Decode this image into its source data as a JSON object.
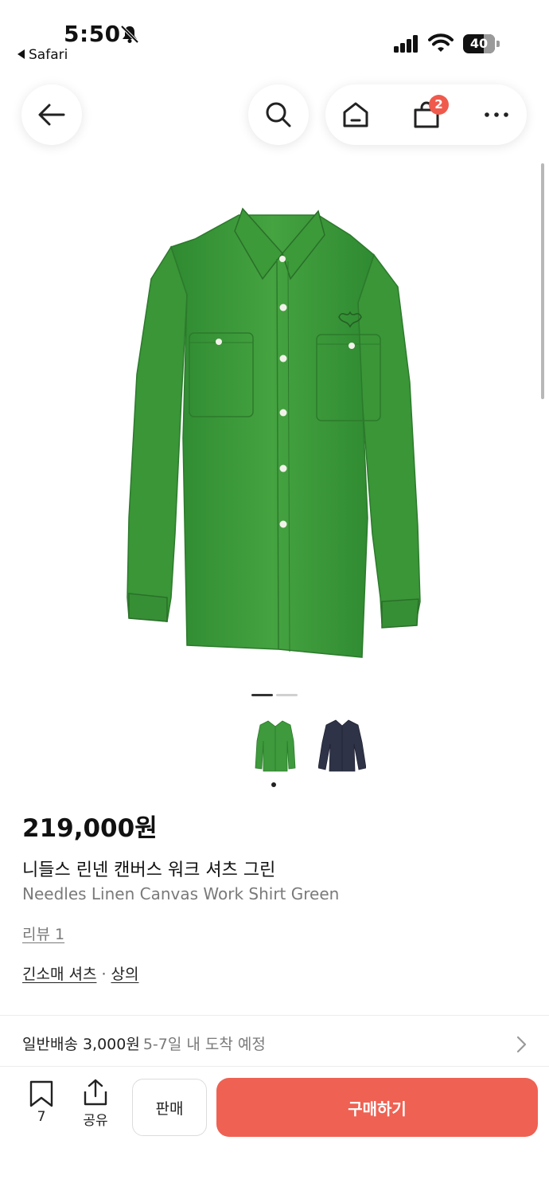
{
  "status_bar": {
    "time": "5:50",
    "back_app": "Safari",
    "battery": "40"
  },
  "nav": {
    "cart_count": "2",
    "icons": [
      "back-arrow-icon",
      "search-icon",
      "home-icon",
      "shopping-bag-icon",
      "more-icon"
    ]
  },
  "gallery": {
    "total_images": 2,
    "current_index": 1,
    "thumbnails": [
      "green-shirt",
      "navy-shirt"
    ]
  },
  "product": {
    "price": "219,000원",
    "name_ko": "니들스 린넨 캔버스 워크 셔츠 그린",
    "name_en": "Needles Linen Canvas Work Shirt Green",
    "review_link": "리뷰 1",
    "category_1": "긴소매 셔츠",
    "category_sep": "·",
    "category_2": "상의"
  },
  "shipping": {
    "label": "일반배송 3,000원",
    "eta": "5-7일 내 도착 예정"
  },
  "bottom_bar": {
    "bookmark_count": "7",
    "share_label": "공유",
    "sell_label": "판매",
    "buy_label": "구매하기"
  },
  "colors": {
    "accent": "#ef6152",
    "badge": "#ef5a4d",
    "shirt_green": "#3e9a3c",
    "shirt_navy": "#2f3347"
  }
}
